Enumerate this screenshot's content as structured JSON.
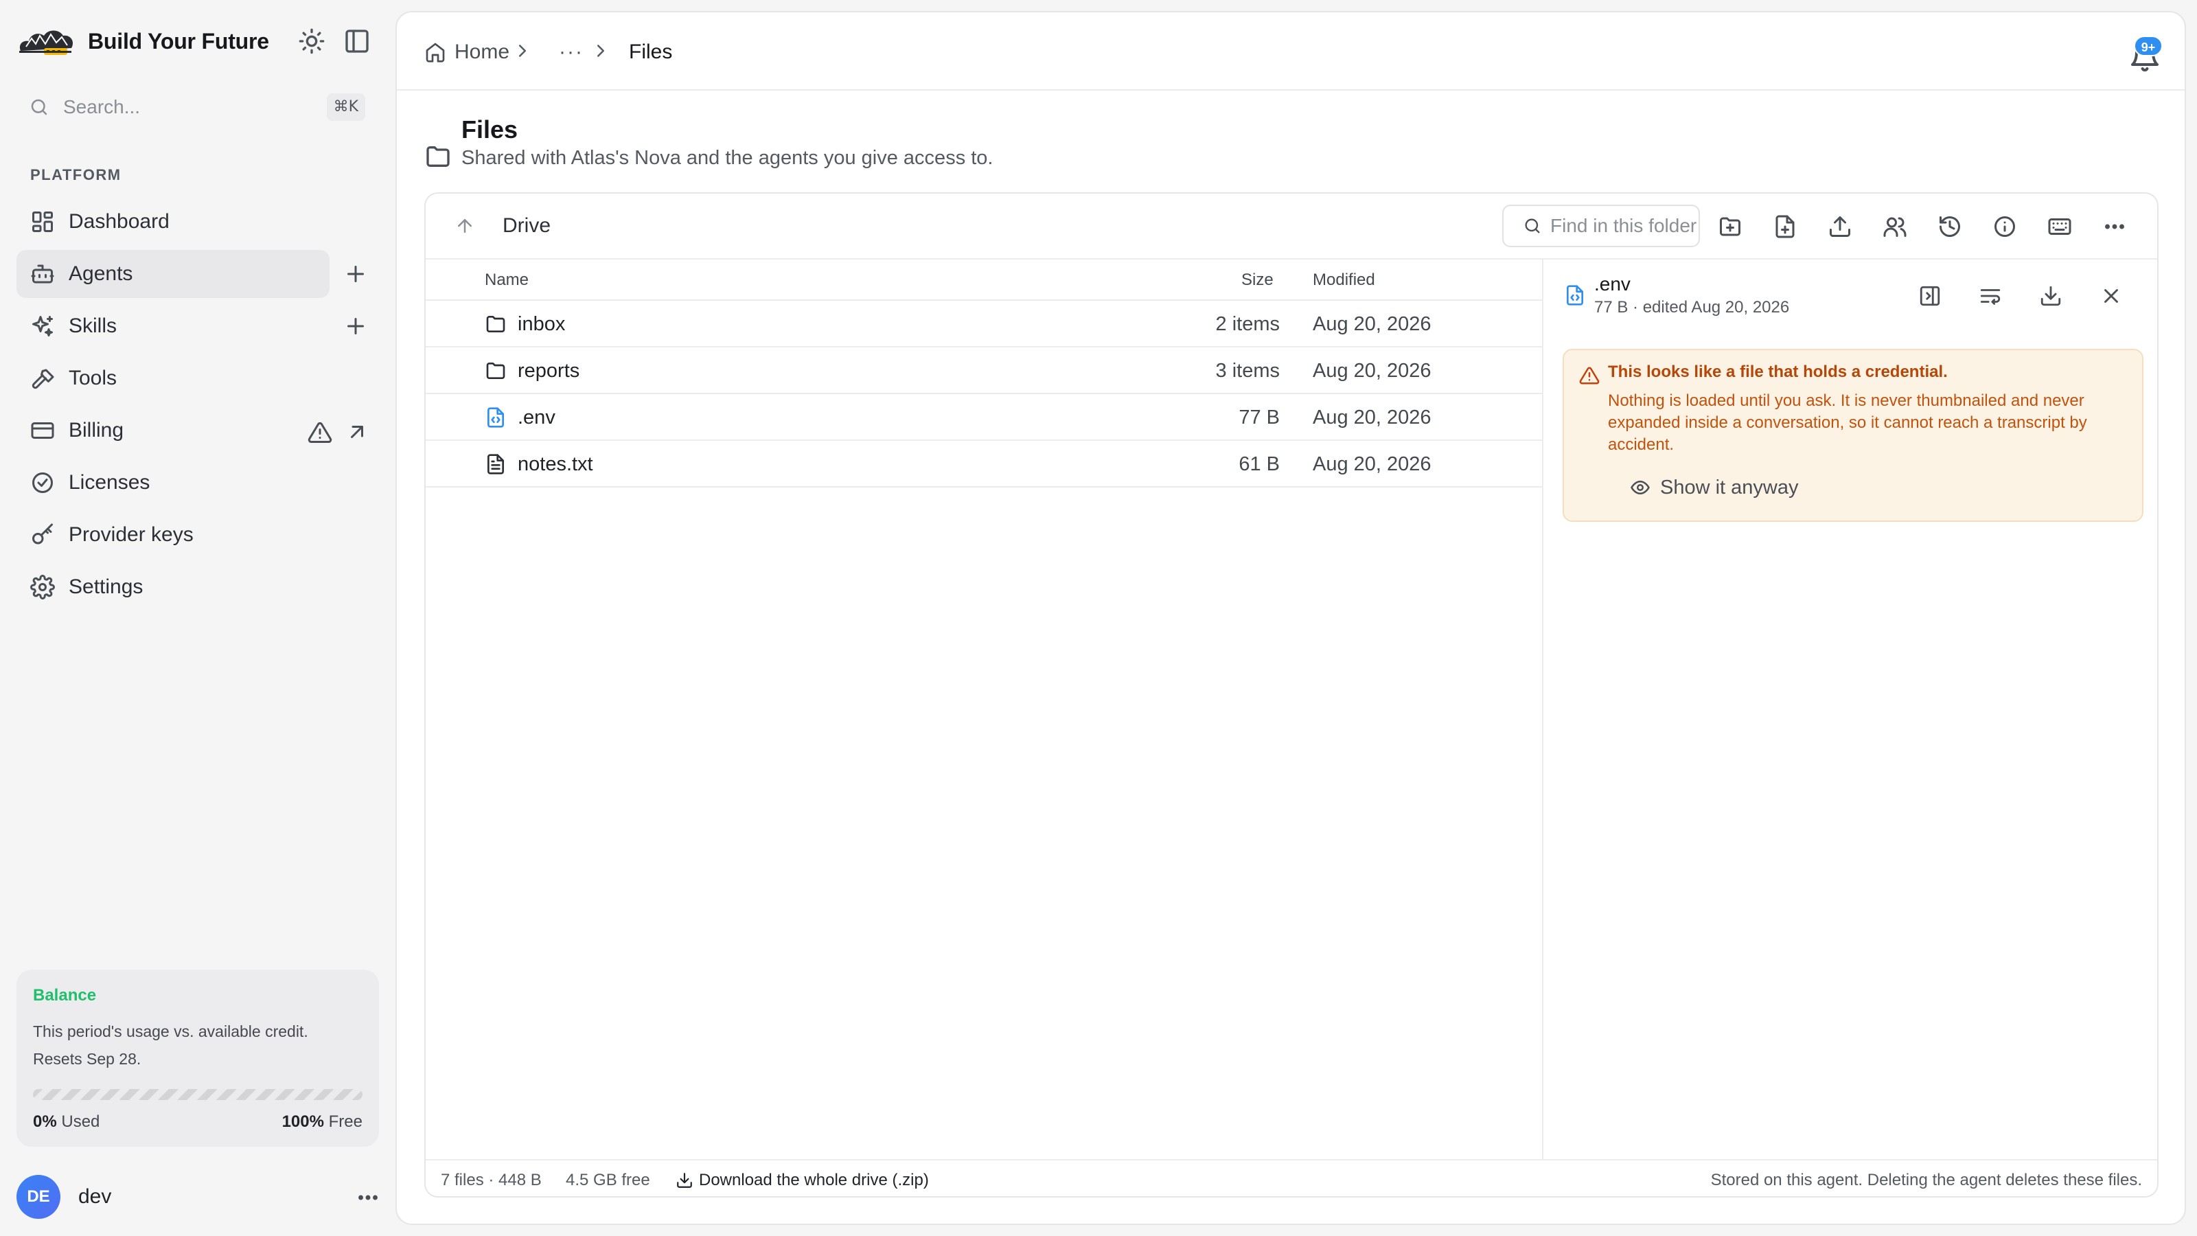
{
  "brand": {
    "name": "Build Your Future"
  },
  "search": {
    "placeholder": "Search...",
    "shortcut": "⌘K"
  },
  "sidebar": {
    "section": "PLATFORM",
    "items": [
      {
        "label": "Dashboard",
        "icon": "dashboard-icon"
      },
      {
        "label": "Agents",
        "icon": "bot-icon",
        "active": true
      },
      {
        "label": "Skills",
        "icon": "sparkles-icon"
      },
      {
        "label": "Tools",
        "icon": "hammer-icon"
      },
      {
        "label": "Billing",
        "icon": "credit-card-icon",
        "warning": true
      },
      {
        "label": "Licenses",
        "icon": "badge-check-icon"
      },
      {
        "label": "Provider keys",
        "icon": "key-icon"
      },
      {
        "label": "Settings",
        "icon": "gear-icon"
      }
    ]
  },
  "balance": {
    "title": "Balance",
    "description": "This period's usage vs. available credit. Resets Sep 28.",
    "used_pct": "0%",
    "used_label": "Used",
    "free_pct": "100%",
    "free_label": "Free",
    "used_fraction": 0
  },
  "user": {
    "initials": "DE",
    "name": "dev"
  },
  "breadcrumb": {
    "home": "Home",
    "ellipsis": "···",
    "current": "Files"
  },
  "notifications": {
    "badge": "9+"
  },
  "page": {
    "title": "Files",
    "subtitle": "Shared with Atlas's Nova and the agents you give access to."
  },
  "drive": {
    "label": "Drive",
    "find_placeholder": "Find in this folder",
    "columns": {
      "name": "Name",
      "size": "Size",
      "modified": "Modified"
    },
    "rows": [
      {
        "name": "inbox",
        "size": "2 items",
        "modified": "Aug 20, 2026",
        "icon": "folder-icon"
      },
      {
        "name": "reports",
        "size": "3 items",
        "modified": "Aug 20, 2026",
        "icon": "folder-icon"
      },
      {
        "name": ".env",
        "size": "77 B",
        "modified": "Aug 20, 2026",
        "icon": "code-file-icon"
      },
      {
        "name": "notes.txt",
        "size": "61 B",
        "modified": "Aug 20, 2026",
        "icon": "text-file-icon"
      }
    ]
  },
  "detail": {
    "name": ".env",
    "meta": "77 B · edited Aug 20, 2026",
    "warning_title": "This looks like a file that holds a credential.",
    "warning_body": "Nothing is loaded until you ask. It is never thumbnailed and never expanded inside a conversation, so it cannot reach a transcript by accident.",
    "show_button": "Show it anyway"
  },
  "footer": {
    "files": "7 files · 448 B",
    "free": "4.5 GB free",
    "download": "Download the whole drive (.zip)",
    "note": "Stored on this agent. Deleting the agent deletes these files."
  },
  "colors": {
    "accent": "#2f8ff0",
    "warning": "#c2520c",
    "balance": "#1fbf6b"
  }
}
